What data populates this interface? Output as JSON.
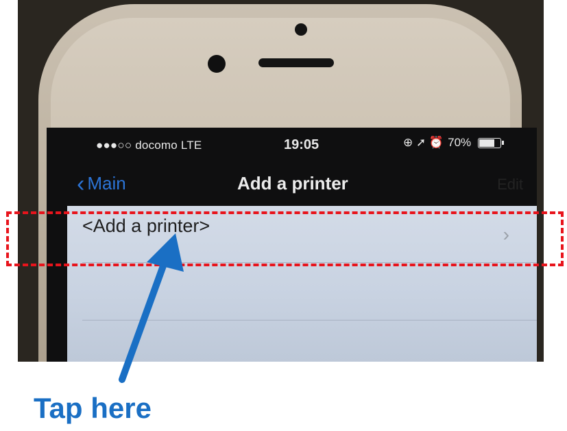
{
  "status_bar": {
    "carrier": "●●●○○ docomo  LTE",
    "time": "19:05",
    "indicators": "⊕ ➚ ⏰",
    "battery": "70%"
  },
  "navbar": {
    "back_label": "Main",
    "title": "Add a printer",
    "right_label": "Edit"
  },
  "list": {
    "rows": [
      {
        "label": "<Add a printer>"
      }
    ]
  },
  "annotation": {
    "instruction": "Tap here",
    "highlight_color": "#e8141c",
    "arrow_color": "#1a6fc4"
  }
}
